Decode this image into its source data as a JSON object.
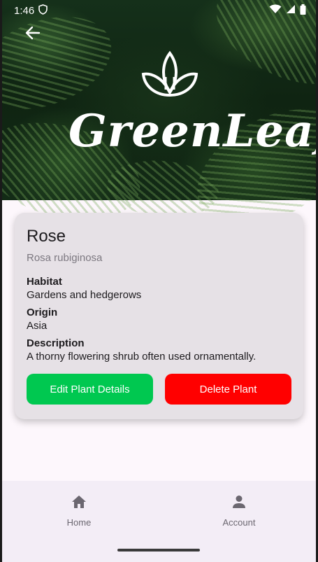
{
  "status_bar": {
    "time": "1:46"
  },
  "hero": {
    "brand": "GreenLeaf"
  },
  "plant": {
    "name": "Rose",
    "scientific_name": "Rosa rubiginosa",
    "fields": [
      {
        "label": "Habitat",
        "value": "Gardens and hedgerows"
      },
      {
        "label": "Origin",
        "value": "Asia"
      },
      {
        "label": "Description",
        "value": "A thorny flowering shrub often used ornamentally."
      }
    ]
  },
  "actions": {
    "edit_label": "Edit Plant Details",
    "delete_label": "Delete Plant"
  },
  "nav": {
    "items": [
      {
        "label": "Home",
        "icon": "home-icon"
      },
      {
        "label": "Account",
        "icon": "person-icon"
      }
    ]
  },
  "colors": {
    "edit": "#00c850",
    "delete": "#ff0000",
    "card": "#e6e1e6"
  }
}
